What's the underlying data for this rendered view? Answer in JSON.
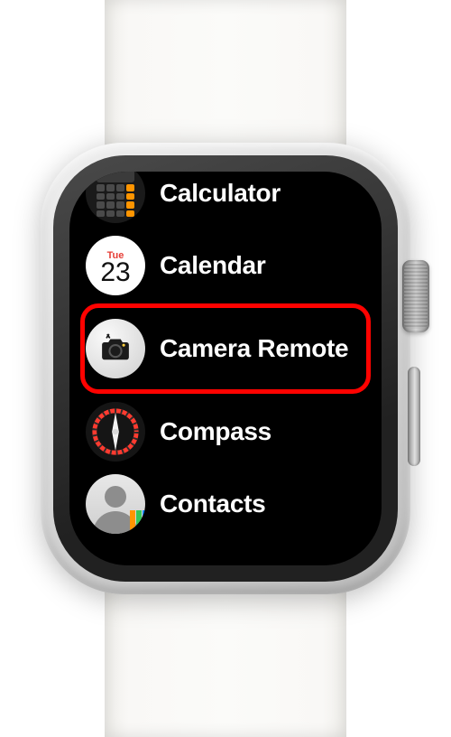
{
  "apps": [
    {
      "id": "calculator",
      "label": "Calculator"
    },
    {
      "id": "calendar",
      "label": "Calendar",
      "day_name": "Tue",
      "day_number": "23"
    },
    {
      "id": "camera-remote",
      "label": "Camera Remote",
      "highlighted": true
    },
    {
      "id": "compass",
      "label": "Compass"
    },
    {
      "id": "contacts",
      "label": "Contacts"
    }
  ],
  "highlight_color": "#ff0200"
}
